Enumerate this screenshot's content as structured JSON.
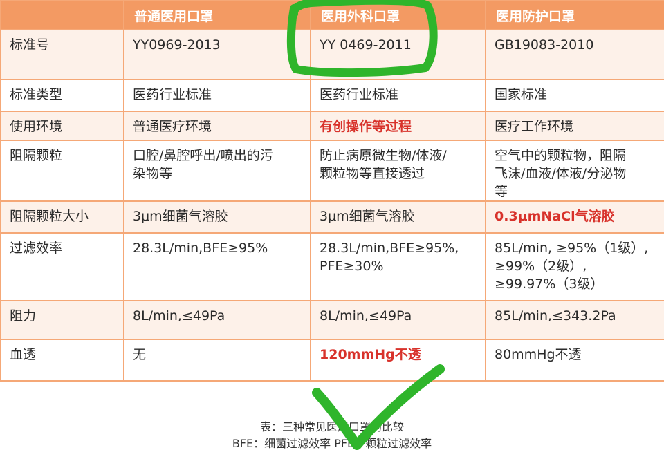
{
  "table": {
    "headers": [
      "",
      "普通医用口罩",
      "医用外科口罩",
      "医用防护口罩"
    ],
    "rows": [
      {
        "label": "标准号",
        "cells": [
          {
            "lines": [
              "YY0969-2013"
            ]
          },
          {
            "lines": [
              "YY 0469-2011"
            ]
          },
          {
            "lines": [
              "GB19083-2010"
            ]
          }
        ]
      },
      {
        "label": "标准类型",
        "cells": [
          {
            "lines": [
              "医药行业标准"
            ]
          },
          {
            "lines": [
              "医药行业标准"
            ]
          },
          {
            "lines": [
              "国家标准"
            ]
          }
        ]
      },
      {
        "label": "使用环境",
        "cells": [
          {
            "lines": [
              "普通医疗环境"
            ]
          },
          {
            "lines": [
              "有创操作等过程"
            ],
            "highlight": true
          },
          {
            "lines": [
              "医疗工作环境"
            ]
          }
        ]
      },
      {
        "label": "阻隔颗粒",
        "cells": [
          {
            "lines": [
              "口腔/鼻腔呼出/喷出的污",
              "染物等"
            ]
          },
          {
            "lines": [
              "防止病原微生物/体液/",
              "颗粒物等直接透过"
            ]
          },
          {
            "lines": [
              "空气中的颗粒物，阻隔",
              "飞沫/血液/体液/分泌物",
              "等"
            ]
          }
        ]
      },
      {
        "label": "阻隔颗粒大小",
        "cells": [
          {
            "lines": [
              "3μm细菌气溶胶"
            ]
          },
          {
            "lines": [
              "3μm细菌气溶胶"
            ]
          },
          {
            "lines": [
              "0.3μmNaCl气溶胶"
            ],
            "highlight": true
          }
        ]
      },
      {
        "label": "过滤效率",
        "cells": [
          {
            "lines": [
              "28.3L/min,BFE≥95%"
            ]
          },
          {
            "lines": [
              "28.3L/min,BFE≥95%,",
              "PFE≥30%"
            ]
          },
          {
            "lines": [
              "85L/min, ≥95%（1级）,",
              "≥99%（2级）,",
              "≥99.97%（3级）"
            ]
          }
        ]
      },
      {
        "label": "阻力",
        "cells": [
          {
            "lines": [
              "8L/min,≤49Pa"
            ]
          },
          {
            "lines": [
              "8L/min,≤49Pa"
            ]
          },
          {
            "lines": [
              "85L/min,≤343.2Pa"
            ]
          }
        ]
      },
      {
        "label": "血透",
        "cells": [
          {
            "lines": [
              "无"
            ]
          },
          {
            "lines": [
              "120mmHg不透"
            ],
            "highlight": true
          },
          {
            "lines": [
              "80mmHg不透"
            ]
          }
        ]
      }
    ]
  },
  "caption": {
    "line1": "表：三种常见医用口罩的比较",
    "line2": "BFE：细菌过滤效率  PFE：颗粒过滤效率"
  },
  "colors": {
    "header_bg": "#f39a63",
    "row_tint": "#fdf1e9",
    "highlight_text": "#d8322b",
    "annotation_green": "#2fb52b"
  }
}
